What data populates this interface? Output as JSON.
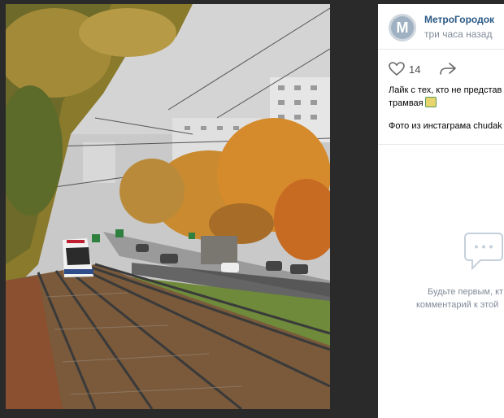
{
  "post": {
    "author": "МетроГородок",
    "time": "три часа назад",
    "avatar_letter": "М",
    "likes": "14",
    "text_line1": "Лайк с тех, кто не представ",
    "text_line2": "трамвая",
    "photo_credit": "Фото из инстаграма chudak"
  },
  "comments": {
    "empty_line1": "Будьте первым, кт",
    "empty_line2": "комментарий к этой"
  },
  "icons": {
    "like": "heart-icon",
    "share": "share-arrow-icon",
    "comment": "comment-bubble-icon",
    "tram": "tram-emoji-icon"
  },
  "colors": {
    "link": "#2a5885",
    "muted": "#818c99",
    "background": "#2b2b2b"
  }
}
